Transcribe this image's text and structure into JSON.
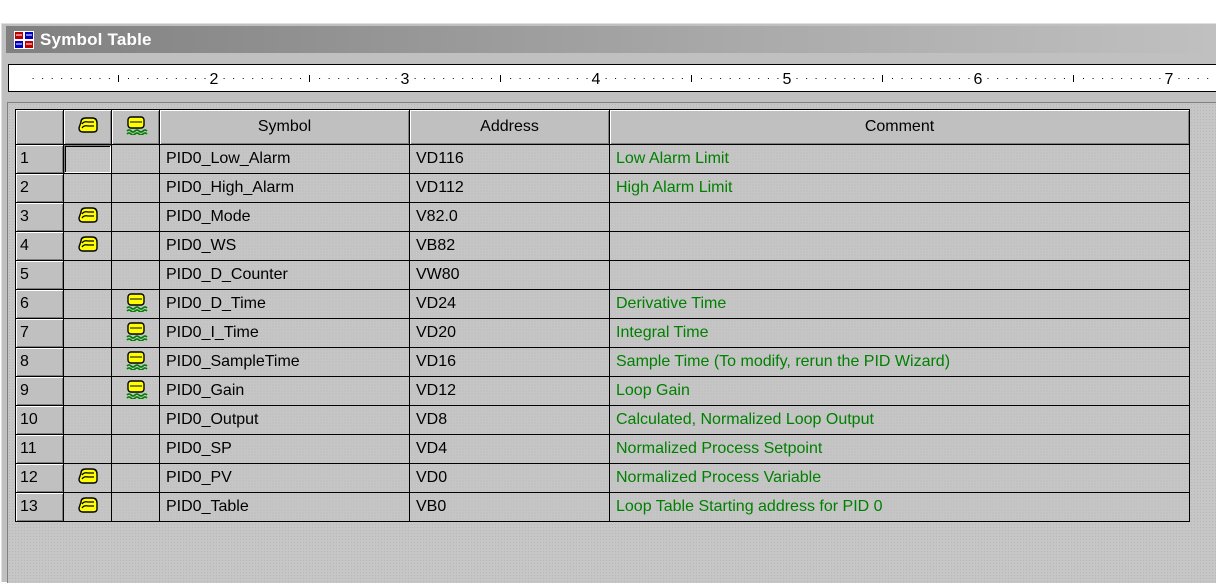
{
  "window": {
    "title": "Symbol Table",
    "app_icon": "symbol-table-app-icon"
  },
  "ruler": {
    "marks": [
      "2",
      "3",
      "4",
      "5",
      "6",
      "7"
    ]
  },
  "columns": {
    "col1_icon": "unused-symbol-icon",
    "col2_icon": "overlapping-address-icon",
    "symbol": "Symbol",
    "address": "Address",
    "comment": "Comment"
  },
  "rows": [
    {
      "num": "1",
      "col1": "",
      "col2": "",
      "symbol": "PID0_Low_Alarm",
      "address": "VD116",
      "comment": "Low Alarm Limit"
    },
    {
      "num": "2",
      "col1": "",
      "col2": "",
      "symbol": "PID0_High_Alarm",
      "address": "VD112",
      "comment": "High Alarm Limit"
    },
    {
      "num": "3",
      "col1": "unused-symbol-icon",
      "col2": "",
      "symbol": "PID0_Mode",
      "address": "V82.0",
      "comment": ""
    },
    {
      "num": "4",
      "col1": "unused-symbol-icon",
      "col2": "",
      "symbol": "PID0_WS",
      "address": "VB82",
      "comment": ""
    },
    {
      "num": "5",
      "col1": "",
      "col2": "",
      "symbol": "PID0_D_Counter",
      "address": "VW80",
      "comment": ""
    },
    {
      "num": "6",
      "col1": "",
      "col2": "overlapping-address-icon",
      "symbol": "PID0_D_Time",
      "address": "VD24",
      "comment": "Derivative Time"
    },
    {
      "num": "7",
      "col1": "",
      "col2": "overlapping-address-icon",
      "symbol": "PID0_I_Time",
      "address": "VD20",
      "comment": "Integral Time"
    },
    {
      "num": "8",
      "col1": "",
      "col2": "overlapping-address-icon",
      "symbol": "PID0_SampleTime",
      "address": "VD16",
      "comment": "Sample Time (To modify, rerun the PID Wizard)"
    },
    {
      "num": "9",
      "col1": "",
      "col2": "overlapping-address-icon",
      "symbol": "PID0_Gain",
      "address": "VD12",
      "comment": "Loop Gain"
    },
    {
      "num": "10",
      "col1": "",
      "col2": "",
      "symbol": "PID0_Output",
      "address": "VD8",
      "comment": "Calculated, Normalized Loop Output"
    },
    {
      "num": "11",
      "col1": "",
      "col2": "",
      "symbol": "PID0_SP",
      "address": "VD4",
      "comment": "Normalized Process Setpoint"
    },
    {
      "num": "12",
      "col1": "unused-symbol-icon",
      "col2": "",
      "symbol": "PID0_PV",
      "address": "VD0",
      "comment": "Normalized Process Variable"
    },
    {
      "num": "13",
      "col1": "unused-symbol-icon",
      "col2": "",
      "symbol": "PID0_Table",
      "address": "VB0",
      "comment": "Loop Table Starting address for PID 0"
    }
  ],
  "colors": {
    "comment_text": "#008000",
    "icon_fill": "#ffff00",
    "title_bar": "#808080"
  }
}
